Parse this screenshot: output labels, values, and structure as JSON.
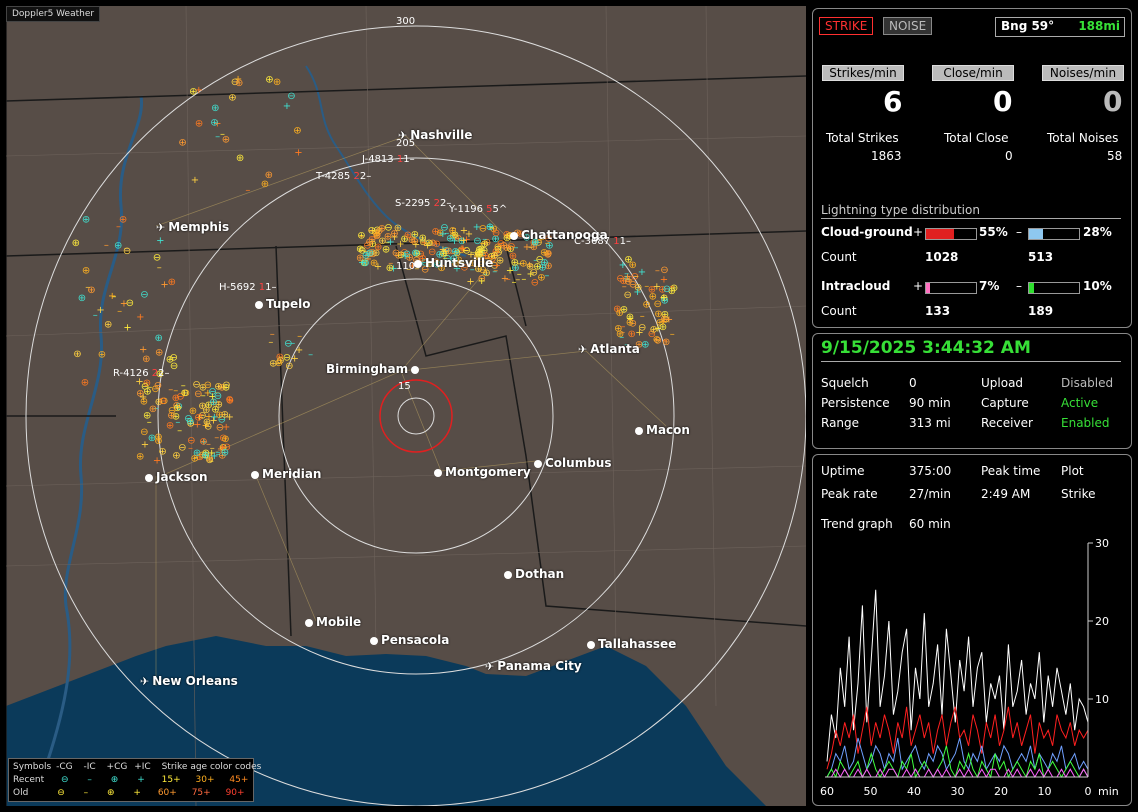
{
  "app": {
    "brand": "Doppler5 Weather"
  },
  "map": {
    "ring_labels": [
      "300",
      "205",
      "110",
      "15"
    ],
    "cities": [
      {
        "name": "Nashville",
        "kind": "airport"
      },
      {
        "name": "Memphis",
        "kind": "airport"
      },
      {
        "name": "Chattanooga",
        "kind": "city"
      },
      {
        "name": "Huntsville",
        "kind": "city"
      },
      {
        "name": "Tupelo",
        "kind": "city"
      },
      {
        "name": "Atlanta",
        "kind": "airport"
      },
      {
        "name": "Birmingham",
        "kind": "city"
      },
      {
        "name": "Macon",
        "kind": "city"
      },
      {
        "name": "Jackson",
        "kind": "city"
      },
      {
        "name": "Meridian",
        "kind": "city"
      },
      {
        "name": "Montgomery",
        "kind": "city"
      },
      {
        "name": "Columbus",
        "kind": "city"
      },
      {
        "name": "Dothan",
        "kind": "city"
      },
      {
        "name": "Mobile",
        "kind": "city"
      },
      {
        "name": "Pensacola",
        "kind": "city"
      },
      {
        "name": "Tallahassee",
        "kind": "city"
      },
      {
        "name": "Panama City",
        "kind": "airport"
      },
      {
        "name": "New Orleans",
        "kind": "airport"
      }
    ],
    "storm_tags": [
      {
        "id": "J-4813",
        "mid": "1",
        "end": "1"
      },
      {
        "id": "T-4285",
        "mid": "2",
        "end": "2"
      },
      {
        "id": "S-2295",
        "mid": "2",
        "end": "2"
      },
      {
        "id": "Y-1196",
        "mid": "5",
        "end": "5"
      },
      {
        "id": "C-3687",
        "mid": "1",
        "end": "1"
      },
      {
        "id": "H-5692",
        "mid": "1",
        "end": "1"
      },
      {
        "id": "R-4126",
        "mid": "2",
        "end": "2"
      }
    ]
  },
  "legend": {
    "symbols_label": "Symbols",
    "cols": [
      "-CG",
      "-IC",
      "+CG",
      "+IC"
    ],
    "recent_label": "Recent",
    "old_label": "Old",
    "age_title": "Strike age color codes",
    "age_recent": [
      "15+",
      "30+",
      "45+"
    ],
    "age_old": [
      "60+",
      "75+",
      "90+"
    ],
    "colors": {
      "recent_neg": "#40e0d0",
      "old_neg": "#ffeb3b",
      "age1": "#ffeb3b",
      "age2": "#ffb020",
      "age3": "#ff7a20",
      "age4": "#ff9a30",
      "age5": "#ff6a40",
      "age6": "#ff5030"
    }
  },
  "panel1": {
    "strike_btn": "STRIKE",
    "noise_btn": "NOISE",
    "bearing": "Bng 59°",
    "distance": "188mi",
    "headers": [
      "Strikes/min",
      "Close/min",
      "Noises/min"
    ],
    "values": [
      "6",
      "0",
      "0"
    ],
    "totals_labels": [
      "Total Strikes",
      "Total Close",
      "Total Noises"
    ],
    "totals_values": [
      "1863",
      "0",
      "58"
    ],
    "dist_title": "Lightning type distribution",
    "cg_label": "Cloud-ground",
    "ic_label": "Intracloud",
    "count_label": "Count",
    "plus": "+",
    "minus": "–",
    "cg_pos_pct": "55%",
    "cg_pos_fill": 55,
    "cg_neg_pct": "28%",
    "cg_neg_fill": 28,
    "cg_pos_count": "1028",
    "cg_neg_count": "513",
    "ic_pos_pct": "7%",
    "ic_pos_fill": 7,
    "ic_neg_pct": "10%",
    "ic_neg_fill": 10,
    "ic_pos_count": "133",
    "ic_neg_count": "189"
  },
  "panel2": {
    "datetime": "9/15/2025 3:44:32 AM",
    "rows": [
      {
        "label": "Squelch",
        "value": "0",
        "label2": "Upload",
        "value2": "Disabled"
      },
      {
        "label": "Persistence",
        "value": "90 min",
        "label2": "Capture",
        "value2": "Active"
      },
      {
        "label": "Range",
        "value": "313 mi",
        "label2": "Receiver",
        "value2": "Enabled"
      }
    ]
  },
  "panel3": {
    "uptime_label": "Uptime",
    "uptime": "375:00",
    "peak_time_label": "Peak time",
    "plot_label": "Plot",
    "peak_rate_label": "Peak rate",
    "peak_rate": "27/min",
    "peak_time": "2:49 AM",
    "plot_value": "Strike",
    "trend_label": "Trend graph",
    "trend_value": "60 min",
    "y_ticks": [
      "30",
      "20",
      "10"
    ],
    "x_ticks": [
      "60",
      "50",
      "40",
      "30",
      "20",
      "10",
      "0"
    ],
    "x_unit": "min",
    "y_max": 30
  },
  "chart_data": {
    "type": "line",
    "x_range": [
      60,
      0
    ],
    "ylim": [
      0,
      30
    ],
    "series": [
      {
        "color": "#ffffff",
        "values": [
          2,
          8,
          5,
          14,
          9,
          18,
          6,
          12,
          22,
          7,
          15,
          24,
          9,
          13,
          20,
          8,
          11,
          16,
          19,
          6,
          14,
          10,
          21,
          9,
          12,
          17,
          8,
          19,
          13,
          7,
          15,
          11,
          18,
          9,
          14,
          16,
          7,
          12,
          10,
          13,
          6,
          17,
          9,
          11,
          15,
          8,
          12,
          10,
          16,
          7,
          13,
          9,
          14,
          11,
          8,
          12,
          6,
          10,
          9,
          7
        ]
      },
      {
        "color": "#ff2020",
        "values": [
          1,
          3,
          6,
          4,
          7,
          5,
          8,
          3,
          6,
          9,
          4,
          7,
          5,
          8,
          6,
          3,
          7,
          5,
          9,
          4,
          6,
          8,
          5,
          7,
          3,
          6,
          8,
          4,
          7,
          9,
          5,
          6,
          4,
          8,
          6,
          3,
          7,
          5,
          8,
          4,
          6,
          9,
          5,
          7,
          4,
          6,
          8,
          3,
          7,
          5,
          6,
          4,
          8,
          6,
          5,
          7,
          4,
          6,
          5,
          6
        ]
      },
      {
        "color": "#70a0ff",
        "values": [
          0,
          1,
          3,
          2,
          4,
          1,
          2,
          5,
          3,
          1,
          2,
          4,
          3,
          1,
          3,
          2,
          5,
          1,
          2,
          3,
          4,
          2,
          1,
          3,
          2,
          4,
          3,
          1,
          2,
          3,
          5,
          2,
          1,
          3,
          2,
          4,
          1,
          2,
          3,
          2,
          4,
          3,
          1,
          2,
          3,
          2,
          4,
          1,
          3,
          2,
          1,
          3,
          2,
          4,
          1,
          2,
          3,
          1,
          2,
          1
        ]
      },
      {
        "color": "#40ff40",
        "values": [
          0,
          1,
          0,
          2,
          1,
          0,
          1,
          2,
          0,
          1,
          3,
          1,
          0,
          1,
          2,
          1,
          0,
          2,
          1,
          3,
          0,
          1,
          2,
          1,
          0,
          1,
          2,
          4,
          1,
          0,
          2,
          1,
          3,
          1,
          0,
          2,
          1,
          0,
          3,
          1,
          2,
          0,
          1,
          2,
          1,
          0,
          2,
          1,
          3,
          0,
          1,
          2,
          1,
          0,
          1,
          2,
          1,
          0,
          1,
          0
        ]
      },
      {
        "color": "#ff60ff",
        "values": [
          0,
          0,
          1,
          0,
          1,
          0,
          0,
          1,
          0,
          1,
          0,
          0,
          1,
          0,
          1,
          1,
          0,
          0,
          1,
          0,
          1,
          0,
          0,
          1,
          0,
          1,
          0,
          1,
          0,
          0,
          1,
          0,
          1,
          0,
          0,
          1,
          0,
          1,
          1,
          0,
          0,
          1,
          0,
          1,
          0,
          0,
          1,
          0,
          1,
          0,
          1,
          0,
          0,
          1,
          0,
          1,
          0,
          0,
          1,
          0
        ]
      }
    ]
  }
}
